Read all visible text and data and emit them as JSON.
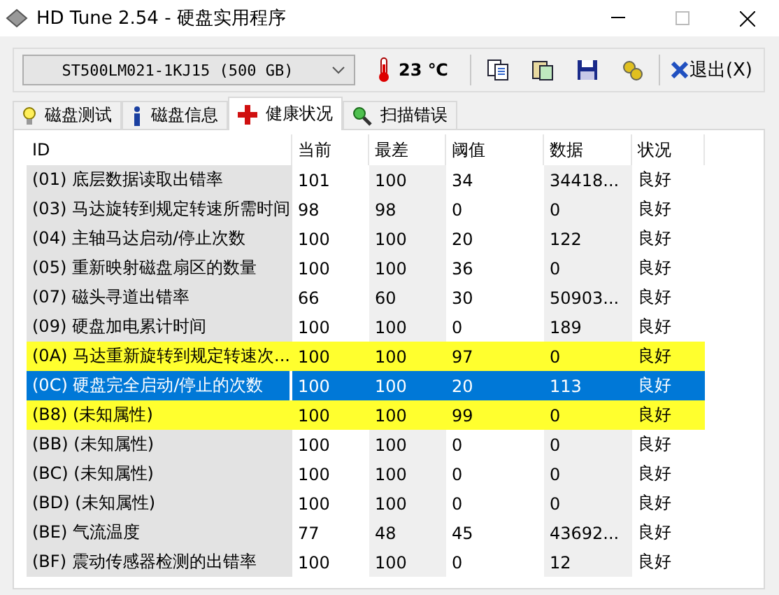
{
  "window": {
    "title": "HD Tune 2.54 - 硬盘实用程序"
  },
  "toolbar": {
    "drive": "ST500LM021-1KJ15 (500 GB)",
    "temperature": "23 ℃",
    "exit_label": "退出(X)"
  },
  "tabs": [
    {
      "label": "磁盘测试",
      "selected": false,
      "kind": "bulb"
    },
    {
      "label": "磁盘信息",
      "selected": false,
      "kind": "info"
    },
    {
      "label": "健康状况",
      "selected": true,
      "kind": "health"
    },
    {
      "label": "扫描错误",
      "selected": false,
      "kind": "scan"
    }
  ],
  "table": {
    "columns": [
      "ID",
      "当前",
      "最差",
      "阈值",
      "数据",
      "状况"
    ],
    "rows": [
      {
        "cells": [
          "(01) 底层数据读取出错率",
          "101",
          "100",
          "34",
          "34418...",
          "良好"
        ],
        "warning": false,
        "selected": false
      },
      {
        "cells": [
          "(03) 马达旋转到规定转速所需时间",
          "98",
          "98",
          "0",
          "0",
          "良好"
        ],
        "warning": false,
        "selected": false
      },
      {
        "cells": [
          "(04) 主轴马达启动/停止次数",
          "100",
          "100",
          "20",
          "122",
          "良好"
        ],
        "warning": false,
        "selected": false
      },
      {
        "cells": [
          "(05) 重新映射磁盘扇区的数量",
          "100",
          "100",
          "36",
          "0",
          "良好"
        ],
        "warning": false,
        "selected": false
      },
      {
        "cells": [
          "(07) 磁头寻道出错率",
          "66",
          "60",
          "30",
          "50903...",
          "良好"
        ],
        "warning": false,
        "selected": false
      },
      {
        "cells": [
          "(09) 硬盘加电累计时间",
          "100",
          "100",
          "0",
          "189",
          "良好"
        ],
        "warning": false,
        "selected": false
      },
      {
        "cells": [
          "(0A) 马达重新旋转到规定转速次...",
          "100",
          "100",
          "97",
          "0",
          "良好"
        ],
        "warning": true,
        "selected": false
      },
      {
        "cells": [
          "(0C) 硬盘完全启动/停止的次数",
          "100",
          "100",
          "20",
          "113",
          "良好"
        ],
        "warning": false,
        "selected": true
      },
      {
        "cells": [
          "(B8) (未知属性)",
          "100",
          "100",
          "99",
          "0",
          "良好"
        ],
        "warning": true,
        "selected": false
      },
      {
        "cells": [
          "(BB) (未知属性)",
          "100",
          "100",
          "0",
          "0",
          "良好"
        ],
        "warning": false,
        "selected": false
      },
      {
        "cells": [
          "(BC) (未知属性)",
          "100",
          "100",
          "0",
          "0",
          "良好"
        ],
        "warning": false,
        "selected": false
      },
      {
        "cells": [
          "(BD) (未知属性)",
          "100",
          "100",
          "0",
          "0",
          "良好"
        ],
        "warning": false,
        "selected": false
      },
      {
        "cells": [
          "(BE) 气流温度",
          "77",
          "48",
          "45",
          "43692...",
          "良好"
        ],
        "warning": false,
        "selected": false
      },
      {
        "cells": [
          "(BF) 震动传感器检测的出错率",
          "100",
          "100",
          "0",
          "12",
          "良好"
        ],
        "warning": false,
        "selected": false
      }
    ]
  }
}
